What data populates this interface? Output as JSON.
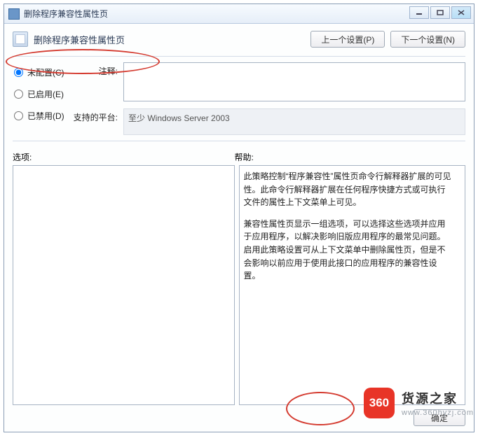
{
  "window": {
    "title": "删除程序兼容性属性页"
  },
  "header": {
    "title": "删除程序兼容性属性页"
  },
  "nav": {
    "prev": "上一个设置(P)",
    "next": "下一个设置(N)"
  },
  "radio": {
    "not_configured": "未配置(C)",
    "enabled": "已启用(E)",
    "disabled": "已禁用(D)"
  },
  "labels": {
    "comment": "注释:",
    "supported": "支持的平台:",
    "options": "选项:",
    "help": "帮助:"
  },
  "fields": {
    "comment_value": "",
    "supported_value": "至少 Windows Server 2003"
  },
  "help": {
    "p1": "此策略控制“程序兼容性”属性页命令行解释器扩展的可见性。此命令行解释器扩展在任何程序快捷方式或可执行文件的属性上下文菜单上可见。",
    "p2": "兼容性属性页显示一组选项，可以选择这些选项并应用于应用程序，以解决影响旧版应用程序的最常见问题。启用此策略设置可从上下文菜单中删除属性页，但是不会影响以前应用于使用此接口的应用程序的兼容性设置。"
  },
  "footer": {
    "ok": "确定"
  },
  "watermark": {
    "badge": "360",
    "brand": "货源之家",
    "url": "www.360hyzj.com"
  }
}
